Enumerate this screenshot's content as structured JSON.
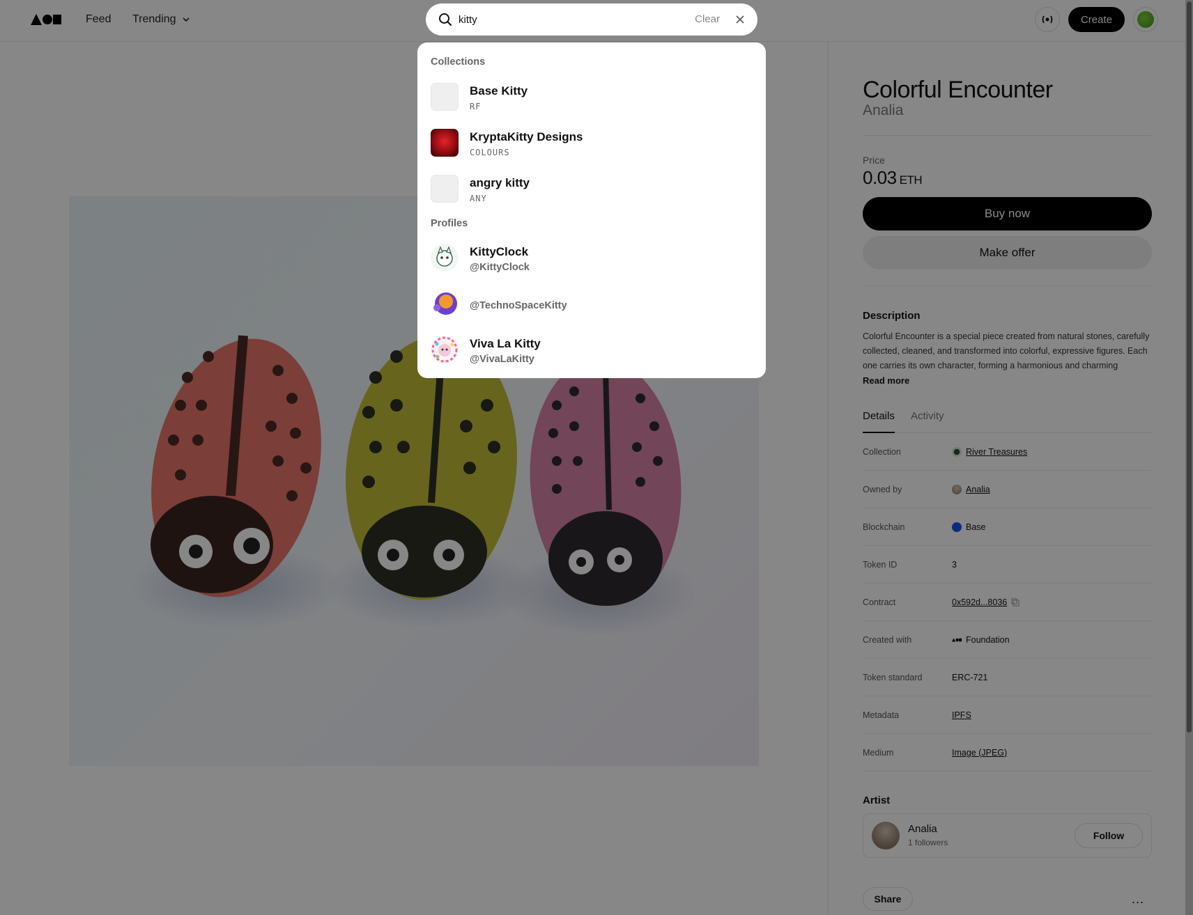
{
  "nav": {
    "logo_icon": "foundation-logo-icon",
    "feed": "Feed",
    "trending": "Trending",
    "create": "Create"
  },
  "search": {
    "value": "kitty",
    "clear": "Clear",
    "collections_header": "Collections",
    "profiles_header": "Profiles",
    "collections": [
      {
        "name": "Base Kitty",
        "symbol": "RF"
      },
      {
        "name": "KryptaKitty Designs",
        "symbol": "COLOURS"
      },
      {
        "name": "angry kitty",
        "symbol": "ANY"
      }
    ],
    "profiles": [
      {
        "name": "KittyClock",
        "handle": "@KittyClock"
      },
      {
        "name": "",
        "handle": "@TechnoSpaceKitty"
      },
      {
        "name": "Viva La Kitty",
        "handle": "@VivaLaKitty"
      }
    ]
  },
  "artwork": {
    "title": "Colorful Encounter",
    "artist": "Analia"
  },
  "price": {
    "label": "Price",
    "amount": "0.03",
    "unit": "ETH",
    "buy": "Buy now",
    "offer": "Make offer"
  },
  "description": {
    "label": "Description",
    "text": "Colorful Encounter is a special piece created from natural stones, carefully collected, cleaned, and transformed into colorful, expressive figures. Each one carries its own character, forming a harmonious and charming",
    "read_more": "Read more"
  },
  "tabs": {
    "details": "Details",
    "activity": "Activity"
  },
  "details": {
    "collection": {
      "label": "Collection",
      "value": "River Treasures"
    },
    "owned_by": {
      "label": "Owned by",
      "value": "Analia"
    },
    "blockchain": {
      "label": "Blockchain",
      "value": "Base"
    },
    "token_id": {
      "label": "Token ID",
      "value": "3"
    },
    "contract": {
      "label": "Contract",
      "value": "0x592d...8036"
    },
    "created_with": {
      "label": "Created with",
      "value": "Foundation"
    },
    "token_standard": {
      "label": "Token standard",
      "value": "ERC-721"
    },
    "metadata": {
      "label": "Metadata",
      "value": "IPFS"
    },
    "medium": {
      "label": "Medium",
      "value": "Image (JPEG)"
    }
  },
  "artist_section": {
    "label": "Artist",
    "name": "Analia",
    "followers": "1 followers",
    "follow": "Follow"
  },
  "actions": {
    "share": "Share",
    "more": "..."
  },
  "colors": {
    "accent": "#000000",
    "base_chain": "#1652f0",
    "avatar_green": "#5bb52a"
  }
}
